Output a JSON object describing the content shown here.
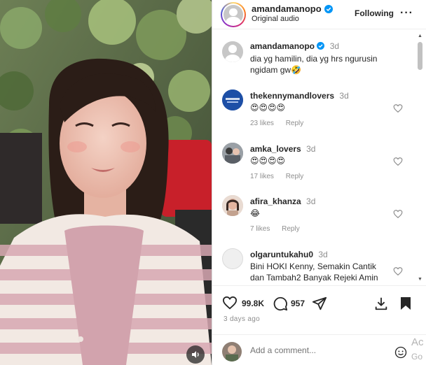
{
  "post_header": {
    "username": "amandamanopo",
    "audio_label": "Original audio",
    "follow_label": "Following",
    "more_icon": "more-horizontal-icon"
  },
  "comments": [
    {
      "username": "amandamanopo",
      "time": "3d",
      "verified": true,
      "text_lines": [
        "dia yg hamilin, dia yg hrs ngurusin",
        "ngidam gw🤣"
      ],
      "likes": "",
      "reply": ""
    },
    {
      "username": "thekennymandlovers",
      "time": "3d",
      "text": "😍😍😍😍",
      "likes": "23 likes",
      "reply": "Reply"
    },
    {
      "username": "amka_lovers",
      "time": "3d",
      "text": "😍😍😍😍",
      "likes": "17 likes",
      "reply": "Reply"
    },
    {
      "username": "afira_khanza",
      "time": "3d",
      "text": "😂",
      "likes": "7 likes",
      "reply": "Reply"
    },
    {
      "username": "olgaruntukahu0",
      "time": "3d",
      "text_lines": [
        "Bini HOKI Kenny, Semakin Cantik",
        "dan Tambah2 Banyak Rejeki Amin"
      ],
      "likes": "",
      "reply": ""
    }
  ],
  "actions": {
    "likes_count": "99.8K",
    "comments_count": "957",
    "posted": "3 days ago"
  },
  "add_comment": {
    "placeholder": "Add a comment..."
  },
  "overlay": {
    "activate_text_1": "Ac",
    "activate_text_2": "Go"
  },
  "colors": {
    "verified_blue": "#0095f6",
    "text_primary": "#262626",
    "text_secondary": "#8e8e8e"
  }
}
